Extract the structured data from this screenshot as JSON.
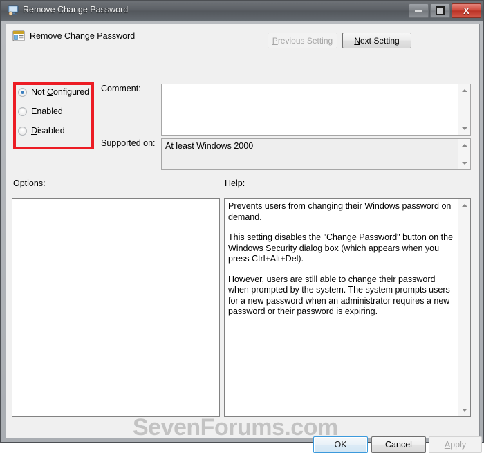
{
  "window": {
    "title": "Remove Change Password",
    "icon": "monitor-policy-icon",
    "caption_buttons": {
      "minimize": "minimize-icon",
      "maximize": "maximize-icon",
      "close": "X"
    }
  },
  "header": {
    "icon": "policy-setting-icon",
    "title": "Remove Change Password",
    "previous_setting": {
      "label_before": "P",
      "accel": "P",
      "label": "Previous Setting",
      "pre": "",
      "mid": "P",
      "post": "revious Setting",
      "disabled": true
    },
    "next_setting": {
      "label": "Next Setting",
      "pre": "",
      "mid": "N",
      "post": "ext Setting",
      "disabled": false
    }
  },
  "state_options": {
    "selected": "Not Configured",
    "items": [
      {
        "label": "Not Configured",
        "pre": "Not ",
        "accel": "C",
        "post": "onfigured",
        "checked": true
      },
      {
        "label": "Enabled",
        "pre": "",
        "accel": "E",
        "post": "nabled",
        "checked": false
      },
      {
        "label": "Disabled",
        "pre": "",
        "accel": "D",
        "post": "isabled",
        "checked": false
      }
    ]
  },
  "annotation": {
    "shape": "rectangle",
    "color": "#ec1c24",
    "targets": "state-option-radios"
  },
  "comment": {
    "label": "Comment:",
    "value": ""
  },
  "supported_on": {
    "label": "Supported on:",
    "value": "At least Windows 2000"
  },
  "options": {
    "label": "Options:",
    "content": ""
  },
  "help": {
    "label": "Help:",
    "paragraphs": [
      "Prevents users from changing their Windows password on demand.",
      "This setting disables the \"Change Password\" button on the Windows Security dialog box (which appears when you press Ctrl+Alt+Del).",
      "However, users are still able to change their password when prompted by the system. The system prompts users for a new password when an administrator requires a new password or their password is expiring."
    ]
  },
  "watermark": {
    "text": "SevenForums.com",
    "color": "#c3c3c3"
  },
  "footer": {
    "ok": {
      "label": "OK",
      "focused": true
    },
    "cancel": {
      "label": "Cancel"
    },
    "apply": {
      "pre": "",
      "accel": "A",
      "post": "pply",
      "label": "Apply",
      "disabled": true
    }
  }
}
